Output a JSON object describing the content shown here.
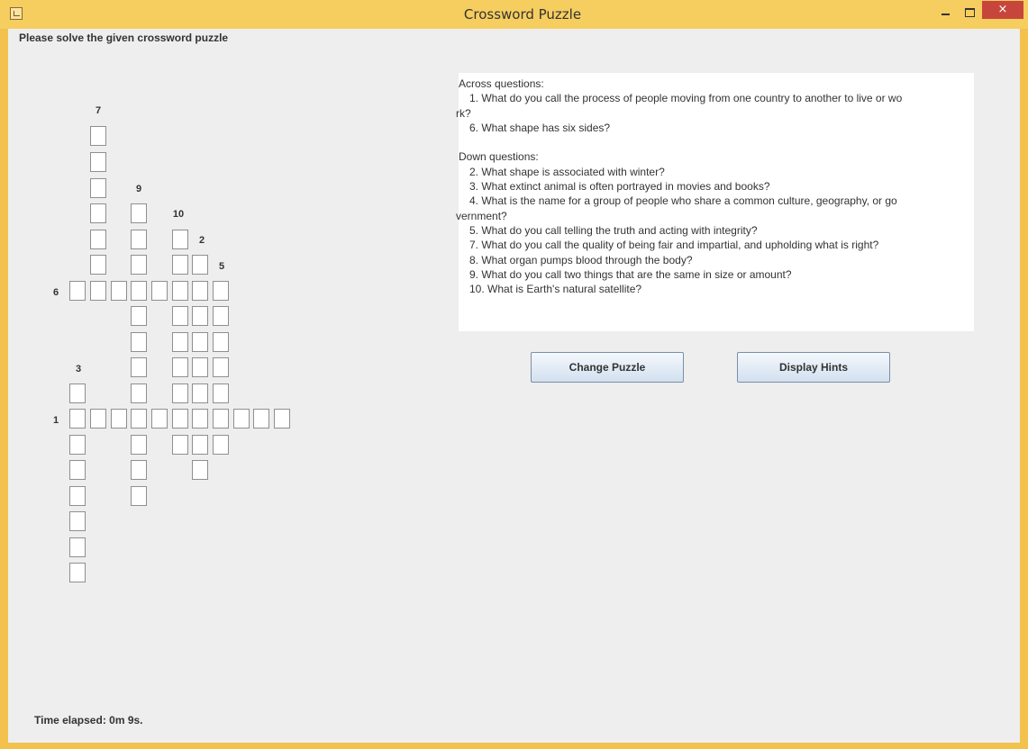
{
  "window": {
    "title": "Crossword Puzzle",
    "close_glyph": "×",
    "icons": [
      "java-app-icon",
      "minimize-icon",
      "maximize-icon",
      "close-icon"
    ]
  },
  "instruction": "Please solve the given crossword puzzle",
  "grid_numbers": [
    "7",
    "9",
    "10",
    "2",
    "5",
    "6",
    "3",
    "1"
  ],
  "clues": {
    "across_heading": "Across questions:",
    "across": [
      {
        "first": "1.  What do you call the process of people moving from one country to another to live or wo",
        "cont": "rk?"
      },
      {
        "first": "6.  What shape has six sides?",
        "cont": ""
      }
    ],
    "down_heading": "Down questions:",
    "down": [
      {
        "first": "2.  What shape is associated with winter?",
        "cont": ""
      },
      {
        "first": "3.  What extinct animal is often portrayed in movies and books?",
        "cont": ""
      },
      {
        "first": "4.  What is the name for a group of people who share a common culture, geography, or go",
        "cont": "vernment?"
      },
      {
        "first": "5.  What do you call telling the truth and acting with integrity?",
        "cont": ""
      },
      {
        "first": "7.  What do you call the quality of being fair and impartial, and upholding what is right?",
        "cont": ""
      },
      {
        "first": "8.  What organ pumps blood through the body?",
        "cont": ""
      },
      {
        "first": "9.  What do you call two things that are the same in size or amount?",
        "cont": ""
      },
      {
        "first": "10.  What is Earth's natural satellite?",
        "cont": ""
      }
    ]
  },
  "buttons": {
    "change_puzzle": "Change Puzzle",
    "display_hints": "Display Hints"
  },
  "timer": "Time elapsed: 0m 9s.",
  "colors": {
    "window_frame": "#f6cd5f",
    "panel_bg": "#eeeeee",
    "close_button": "#c7463b"
  }
}
